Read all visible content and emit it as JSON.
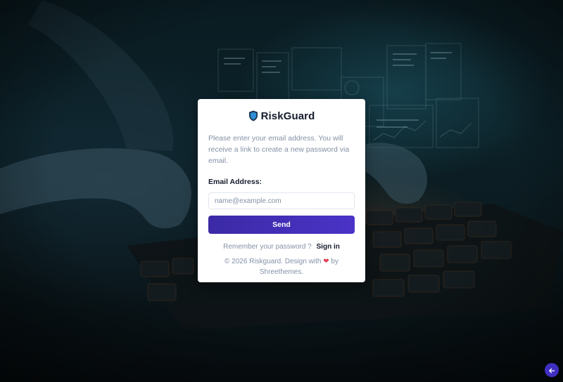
{
  "brand": {
    "name": "RiskGuard",
    "logo_icon": "shield-icon",
    "accent": "#3f2fc1"
  },
  "form": {
    "intro": "Please enter your email address. You will receive a link to create a new password via email.",
    "email_label": "Email Address:",
    "email_placeholder": "name@example.com",
    "email_value": "",
    "submit_label": "Send"
  },
  "remember": {
    "text": "Remember your password ?",
    "link_label": "Sign in"
  },
  "footer": {
    "prefix": "© 2026 Riskguard. Design with",
    "heart_icon": "heart-icon",
    "suffix": "by Shreethemes."
  },
  "back_button": {
    "icon": "arrow-left-icon"
  }
}
